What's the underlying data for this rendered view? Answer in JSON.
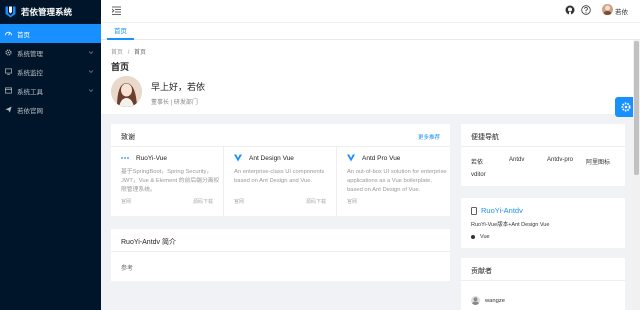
{
  "app": {
    "title": "若依管理系统"
  },
  "sidebar": {
    "items": [
      {
        "label": "首页",
        "active": true
      },
      {
        "label": "系统管理"
      },
      {
        "label": "系统监控"
      },
      {
        "label": "系统工具"
      },
      {
        "label": "若依官网"
      }
    ]
  },
  "header": {
    "username": "若依"
  },
  "tabs": [
    {
      "label": "首页"
    }
  ],
  "breadcrumb": {
    "root": "首页",
    "separator": "/",
    "current": "首页"
  },
  "page": {
    "title": "首页",
    "greeting": "早上好，若依",
    "role": "董事长 | 研发部门"
  },
  "thanks": {
    "title": "致谢",
    "extra": "更多推荐",
    "projects": [
      {
        "name": "RuoYi-Vue",
        "desc": "基于SpringBoot，Spring Security，JWT，Vue & Element 的前后端分离权限管理系统。",
        "foot_left": "官网",
        "foot_right": "源码下载"
      },
      {
        "name": "Ant Design Vue",
        "desc": "An enterprise-class UI components based on Ant Design and Vue.",
        "foot_left": "官网",
        "foot_right": "源码下载"
      },
      {
        "name": "Antd Pro Vue",
        "desc": "An out-of-box UI solution for enterprise applications as a Vue boilerplate, based on Ant Design of Vue.",
        "foot_left": "官网",
        "foot_right": ""
      }
    ]
  },
  "intro": {
    "title": "RuoYi-Antdv 简介",
    "body": "参考"
  },
  "quick_nav": {
    "title": "便捷导航",
    "links": [
      "若依",
      "Antdv",
      "Antdv-pro",
      "阿里图标",
      "vditor"
    ]
  },
  "repo": {
    "name": "RuoYi-Antdv",
    "desc": "RuoYi-Vue版本+Ant Design Vue",
    "lang": "Vue"
  },
  "contributors": {
    "title": "贡献者",
    "items": [
      {
        "name": "wangze"
      }
    ]
  },
  "colors": {
    "primary": "#1890ff",
    "sider": "#001529"
  }
}
